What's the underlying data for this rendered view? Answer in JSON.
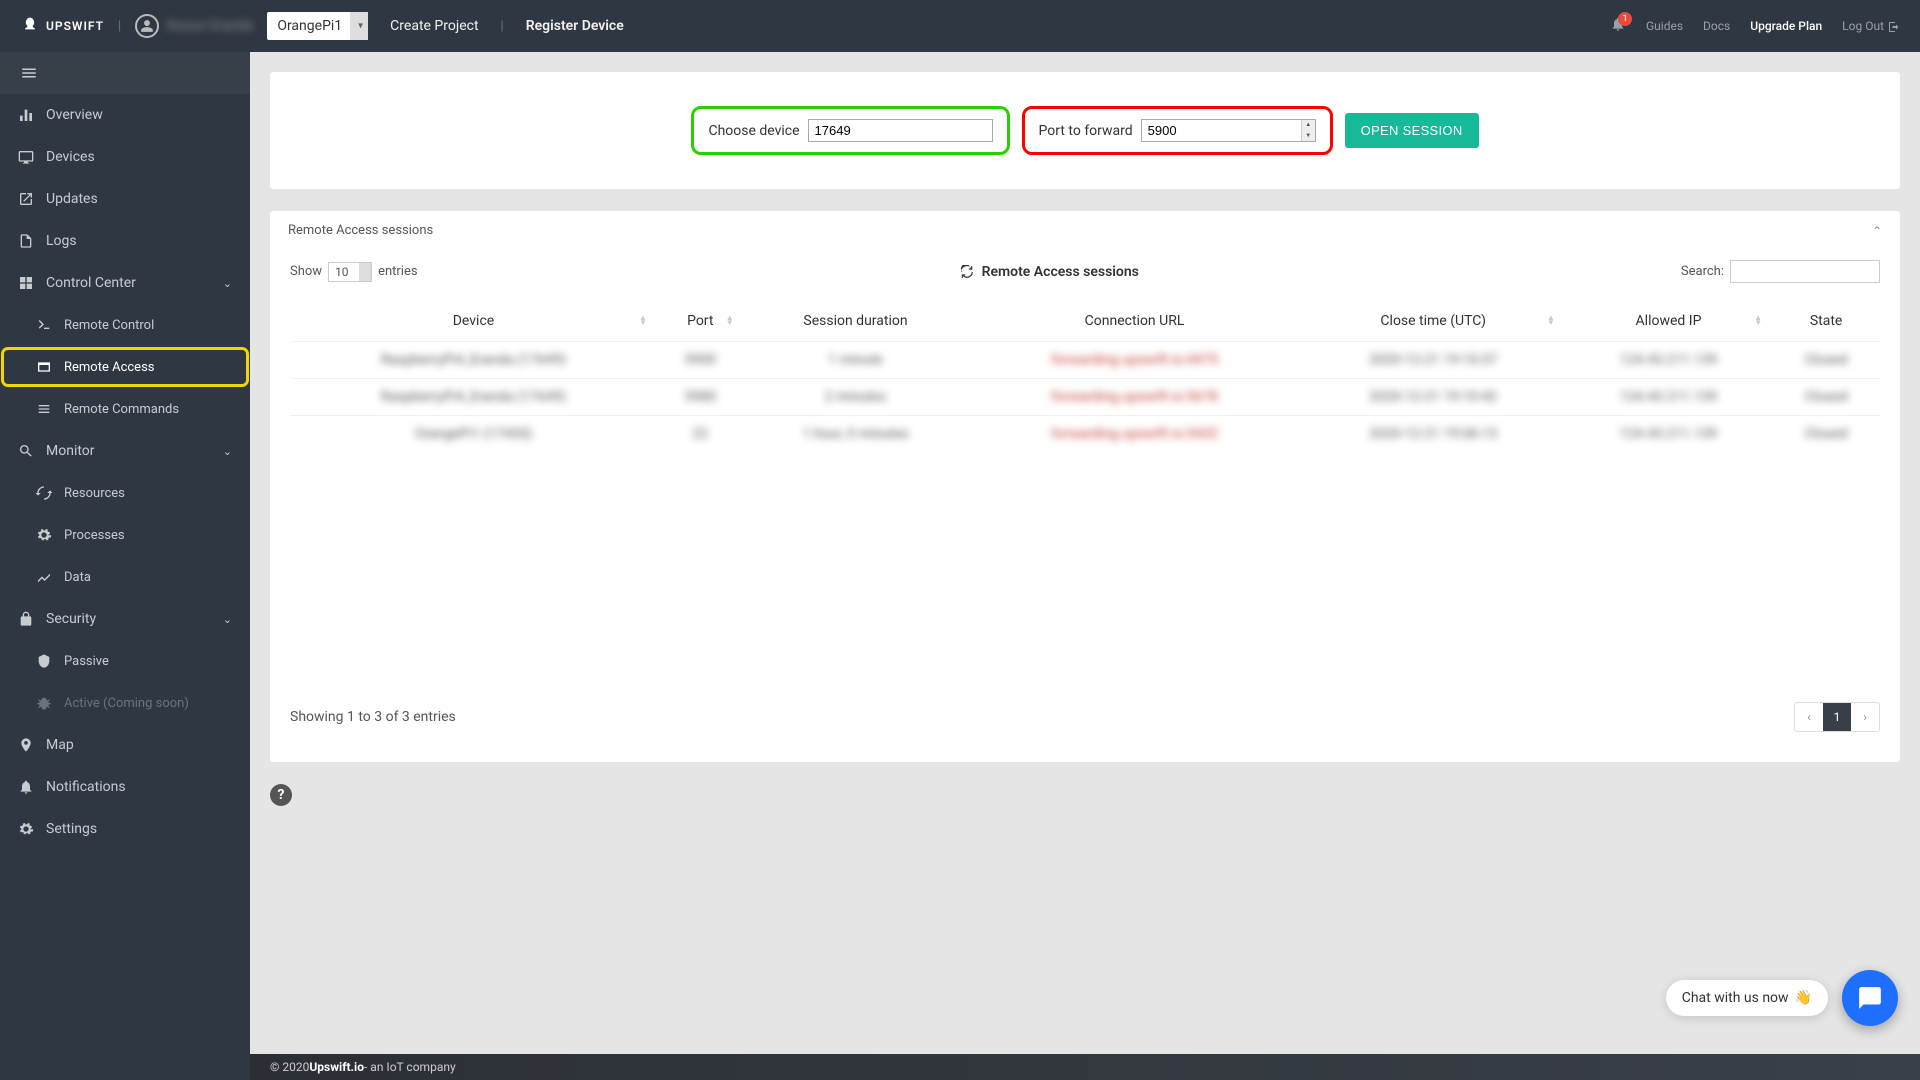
{
  "header": {
    "brand": "UPSWIFT",
    "user_name": "Kasun Eranda",
    "project_selected": "OrangePi1",
    "create_project": "Create Project",
    "register_device": "Register Device",
    "notif_count": "1",
    "guides": "Guides",
    "docs": "Docs",
    "upgrade": "Upgrade Plan",
    "logout": "Log Out"
  },
  "sidebar": {
    "items": [
      {
        "label": "Overview"
      },
      {
        "label": "Devices"
      },
      {
        "label": "Updates"
      },
      {
        "label": "Logs"
      },
      {
        "label": "Control Center"
      },
      {
        "label": "Remote Control"
      },
      {
        "label": "Remote Access"
      },
      {
        "label": "Remote Commands"
      },
      {
        "label": "Monitor"
      },
      {
        "label": "Resources"
      },
      {
        "label": "Processes"
      },
      {
        "label": "Data"
      },
      {
        "label": "Security"
      },
      {
        "label": "Passive"
      },
      {
        "label": "Active (Coming soon)"
      },
      {
        "label": "Map"
      },
      {
        "label": "Notifications"
      },
      {
        "label": "Settings"
      }
    ]
  },
  "form": {
    "choose_device_label": "Choose device",
    "choose_device_value": "17649",
    "port_label": "Port to forward",
    "port_value": "5900",
    "open_button": "OPEN SESSION"
  },
  "sessions": {
    "title": "Remote Access sessions",
    "refresh_label": "Remote Access sessions",
    "show_label_pre": "Show",
    "show_value": "10",
    "show_label_post": "entries",
    "search_label": "Search:",
    "columns": [
      "Device",
      "Port",
      "Session duration",
      "Connection URL",
      "Close time (UTC)",
      "Allowed IP",
      "State"
    ],
    "rows": [
      {
        "device": "RaspberryPi4_Eranda (17649)",
        "port": "5900",
        "duration": "1 minute",
        "url": "forwarding.upswift.io:4475",
        "close": "2020-12-21 19:10:37",
        "ip": "124.43.211.139",
        "state": "Closed"
      },
      {
        "device": "RaspberryPi4_Eranda (17649)",
        "port": "5980",
        "duration": "2 minutes",
        "url": "forwarding.upswift.io:5678",
        "close": "2020-12-21 19:10:42",
        "ip": "124.43.211.139",
        "state": "Closed"
      },
      {
        "device": "OrangePi1 (17455)",
        "port": "22",
        "duration": "1 hour, 0 minutes",
        "url": "forwarding.upswift.io:5432",
        "close": "2020-12-21 19:06:13",
        "ip": "124.43.211.139",
        "state": "Closed"
      }
    ],
    "showing_info": "Showing 1 to 3 of 3 entries",
    "page_current": "1"
  },
  "chat": {
    "message": "Chat with us now",
    "emoji": "👋"
  },
  "footer": {
    "copyright": "© 2020 ",
    "brand": "Upswift.io",
    "tagline": " - an IoT company"
  }
}
